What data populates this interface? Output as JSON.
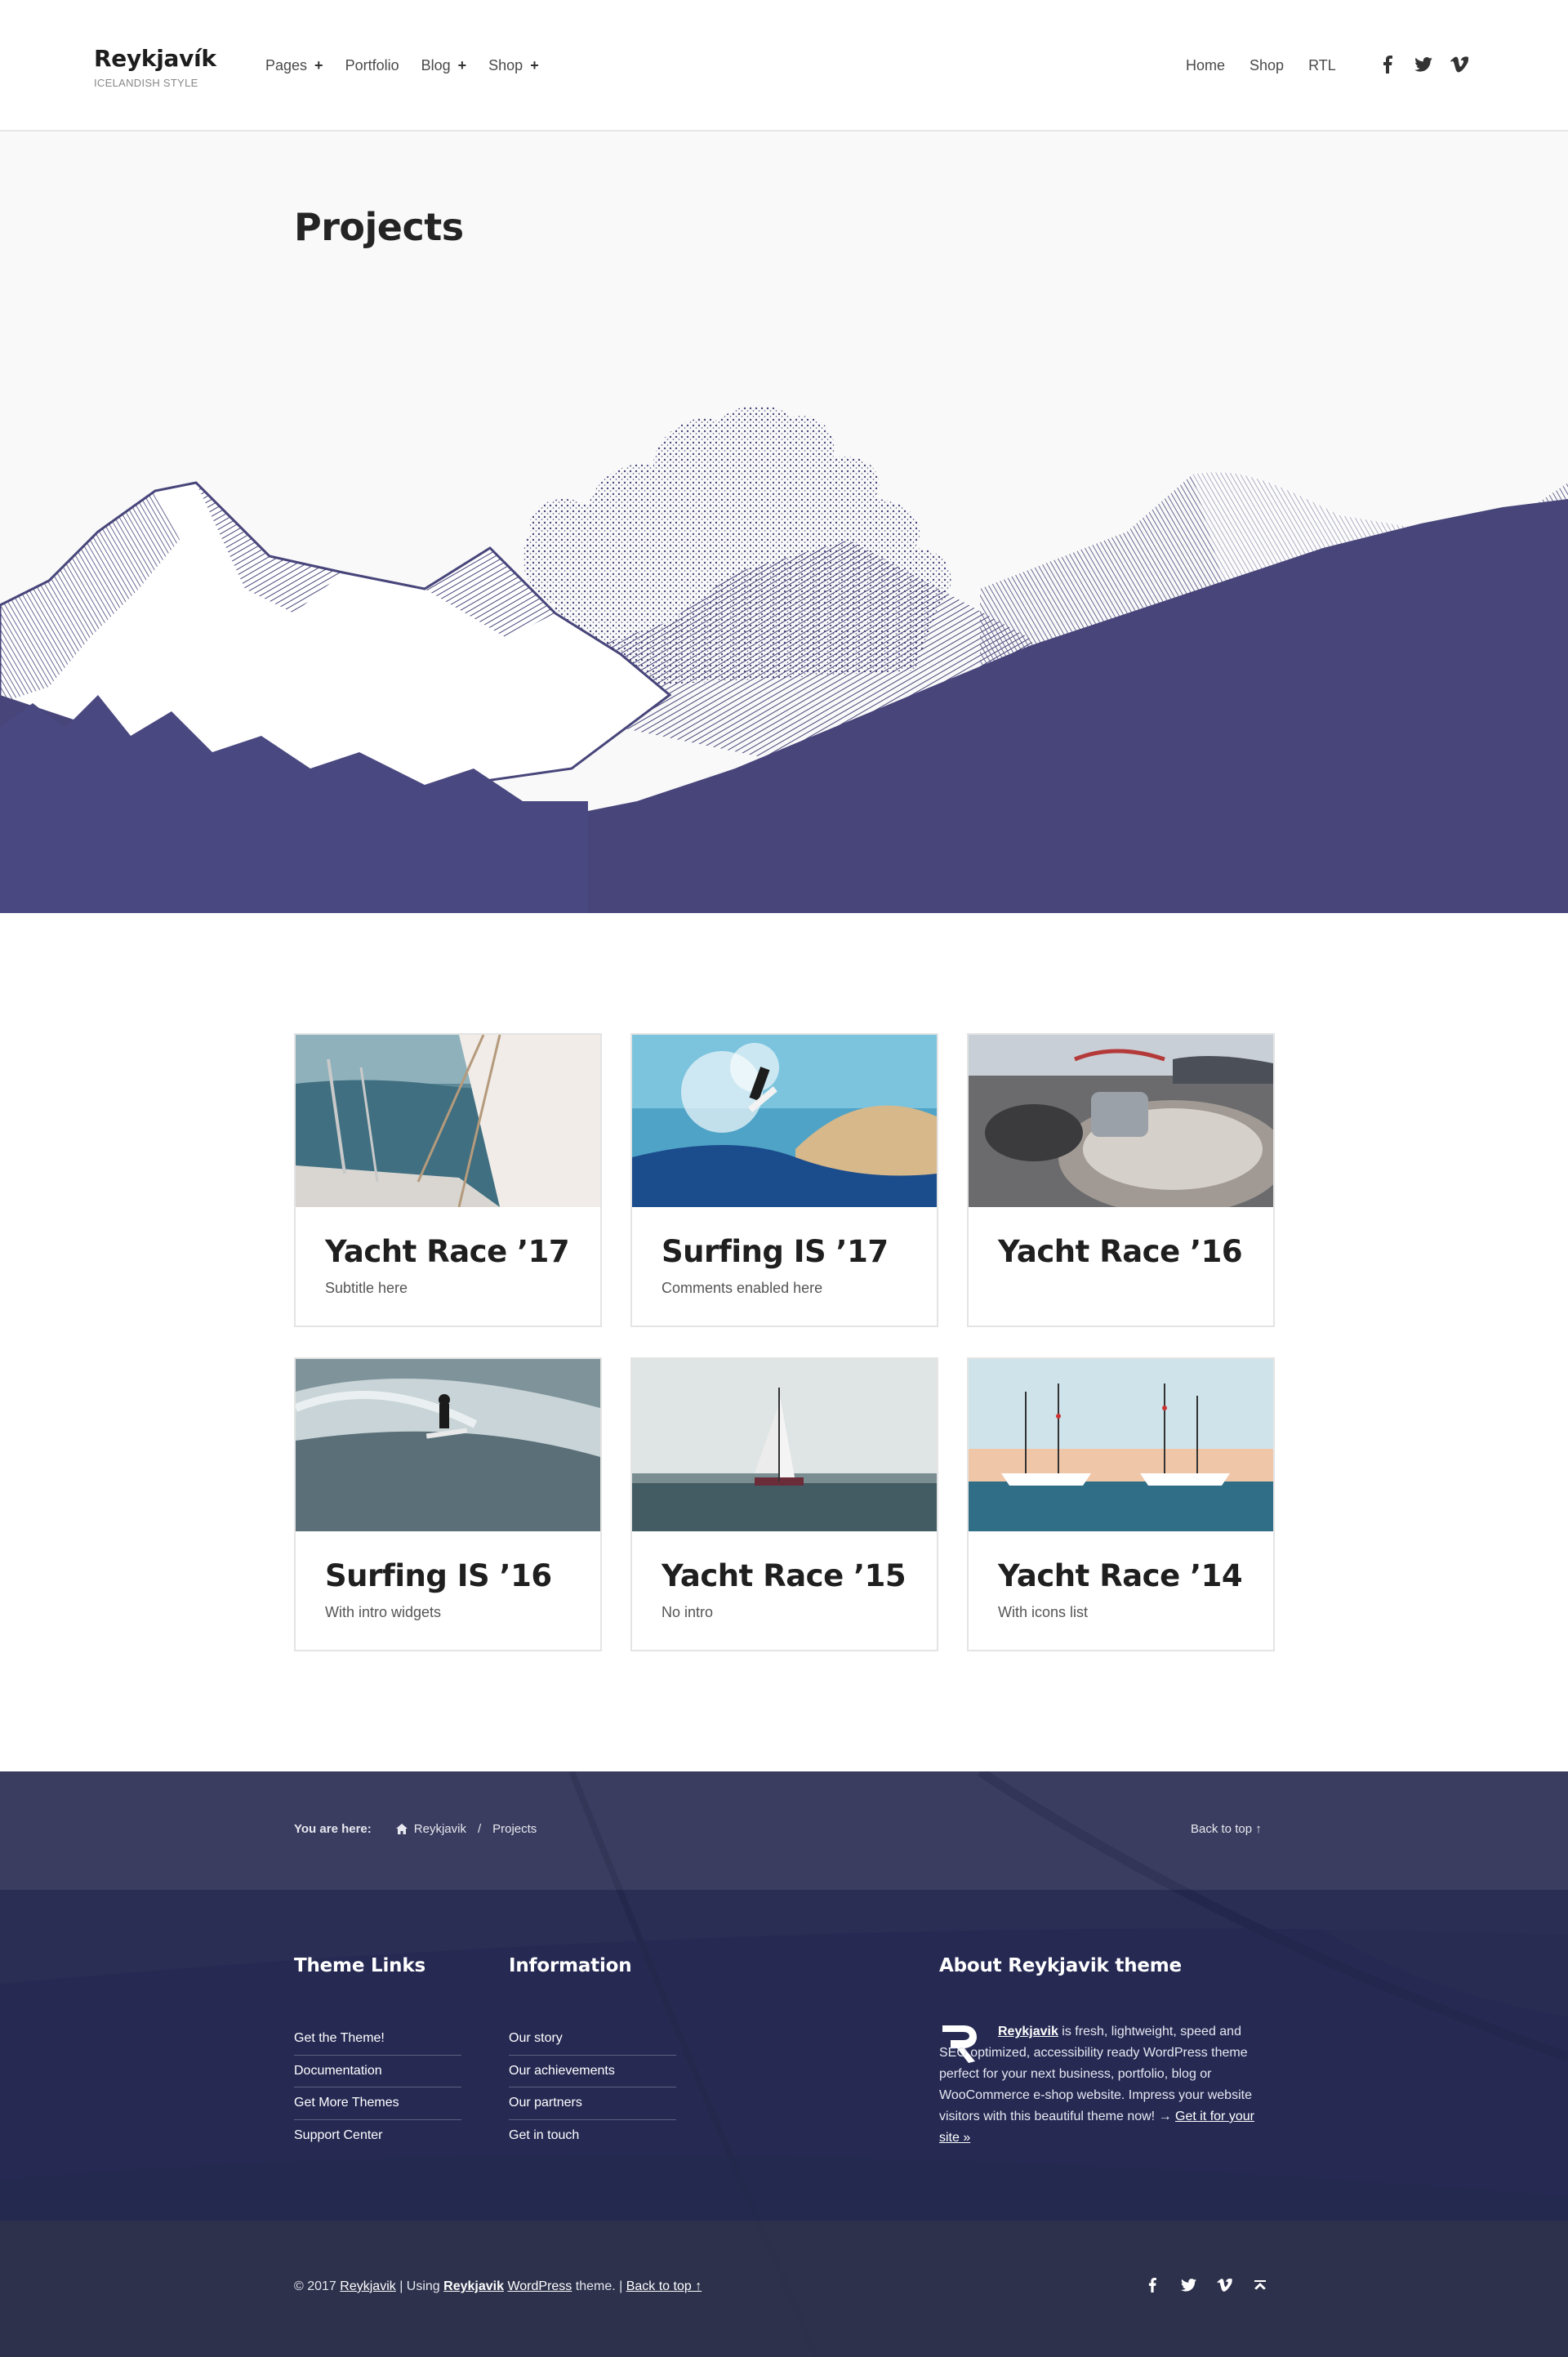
{
  "header": {
    "site_title": "Reykjavík",
    "site_tagline": "ICELANDISH STYLE",
    "nav": [
      {
        "label": "Pages",
        "has_submenu": true
      },
      {
        "label": "Portfolio",
        "has_submenu": false
      },
      {
        "label": "Blog",
        "has_submenu": true
      },
      {
        "label": "Shop",
        "has_submenu": true
      }
    ],
    "submenu_marker": "+",
    "secondary_nav": [
      "Home",
      "Shop",
      "RTL"
    ],
    "social_icons": [
      "facebook-icon",
      "twitter-icon",
      "vimeo-icon"
    ]
  },
  "intro": {
    "title": "Projects",
    "art_color": "#47457a"
  },
  "projects": [
    {
      "title": "Yacht Race ’17",
      "subtitle": "Subtitle here",
      "image": "yacht-deck-photo"
    },
    {
      "title": "Surfing IS ’17",
      "subtitle": "Comments enabled here",
      "image": "surfer-splash-photo"
    },
    {
      "title": "Yacht Race ’16",
      "subtitle": "",
      "image": "rope-winch-photo"
    },
    {
      "title": "Surfing IS ’16",
      "subtitle": "With intro widgets",
      "image": "surfer-wave-photo"
    },
    {
      "title": "Yacht Race ’15",
      "subtitle": "No intro",
      "image": "sailboat-sea-photo"
    },
    {
      "title": "Yacht Race ’14",
      "subtitle": "With icons list",
      "image": "yachts-harbor-photo"
    }
  ],
  "breadcrumbs": {
    "label": "You are here:",
    "home": "Reykjavik",
    "separator": "/",
    "current": "Projects",
    "back_to_top": "Back to top ↑"
  },
  "footer": {
    "theme_links_title": "Theme Links",
    "theme_links": [
      "Get the Theme!",
      "Documentation",
      "Get More Themes",
      "Support Center"
    ],
    "information_title": "Information",
    "information_links": [
      "Our story",
      "Our achievements",
      "Our partners",
      "Get in touch"
    ],
    "about_title": "About Reykjavik theme",
    "about_link": "Reykjavik",
    "about_text": " is fresh, lightweight, speed and SEO optimized, accessibility ready WordPress theme perfect for your next business, portfolio, blog or WooCommerce e-shop website. Impress your website visitors with this beautiful theme now! → ",
    "about_cta": "Get it for your site »"
  },
  "credits": {
    "copyright": "© 2017 ",
    "site_link": "Reykjavik",
    "using": " | Using ",
    "theme_link": "Reykjavik",
    "wp_link": "WordPress",
    "theme_word": " theme. | ",
    "back_to_top": "Back to top ↑",
    "social_icons": [
      "facebook-icon",
      "twitter-icon",
      "vimeo-icon",
      "back-to-top-icon"
    ]
  },
  "colors": {
    "accent_dark": "#25294f",
    "art_blue": "#47457a",
    "card_border": "#e4e4e4"
  }
}
